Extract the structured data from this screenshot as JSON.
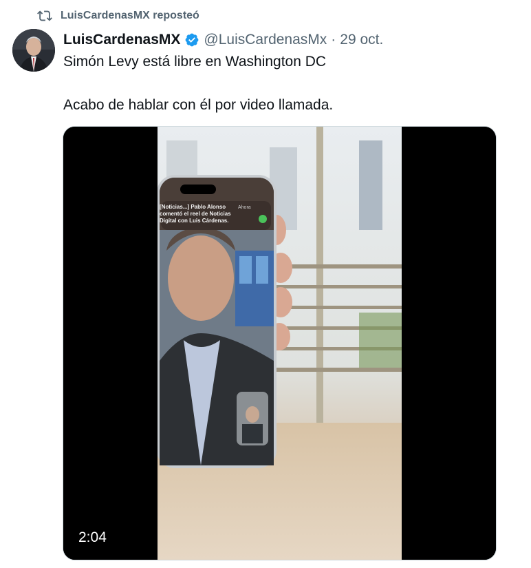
{
  "repost": {
    "icon": "repost-icon",
    "label": "LuisCardenasMX reposteó"
  },
  "tweet": {
    "display_name": "LuisCardenasMX",
    "verified_icon": "verified-badge-icon",
    "handle": "@LuisCardenasMx",
    "separator": "·",
    "date": "29 oct.",
    "line1": "Simón Levy está libre en Washington DC",
    "line2": "Acabo de hablar con él por video llamada."
  },
  "media": {
    "duration": "2:04",
    "notification_text": "[Noticias...] Pablo Alonso comentó el reel de Noticias Digital con Luis Cárdenas.",
    "notification_time": "Ahora"
  },
  "colors": {
    "accent": "#1d9bf0",
    "secondary_text": "#536471",
    "primary_text": "#0f1419"
  }
}
